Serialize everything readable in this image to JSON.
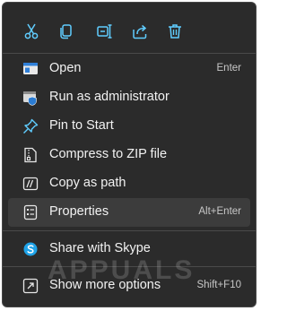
{
  "toolbar": {
    "items": [
      {
        "icon": "cut-icon"
      },
      {
        "icon": "copy-icon"
      },
      {
        "icon": "rename-icon"
      },
      {
        "icon": "share-icon"
      },
      {
        "icon": "delete-icon"
      }
    ]
  },
  "menu": {
    "items": [
      {
        "label": "Open",
        "shortcut": "Enter",
        "icon": "open-app-icon"
      },
      {
        "label": "Run as administrator",
        "shortcut": "",
        "icon": "shield-icon"
      },
      {
        "label": "Pin to Start",
        "shortcut": "",
        "icon": "pin-icon"
      },
      {
        "label": "Compress to ZIP file",
        "shortcut": "",
        "icon": "zip-icon"
      },
      {
        "label": "Copy as path",
        "shortcut": "",
        "icon": "copy-path-icon"
      },
      {
        "label": "Properties",
        "shortcut": "Alt+Enter",
        "icon": "properties-icon"
      },
      {
        "label": "Share with Skype",
        "shortcut": "",
        "icon": "skype-icon"
      },
      {
        "label": "Show more options",
        "shortcut": "Shift+F10",
        "icon": "more-options-icon"
      }
    ]
  },
  "watermark": "APPUALS",
  "colors": {
    "background": "#2b2b2b",
    "accent": "#60cdff",
    "text": "#f2f2f2",
    "hover": "#3c3c3c"
  }
}
